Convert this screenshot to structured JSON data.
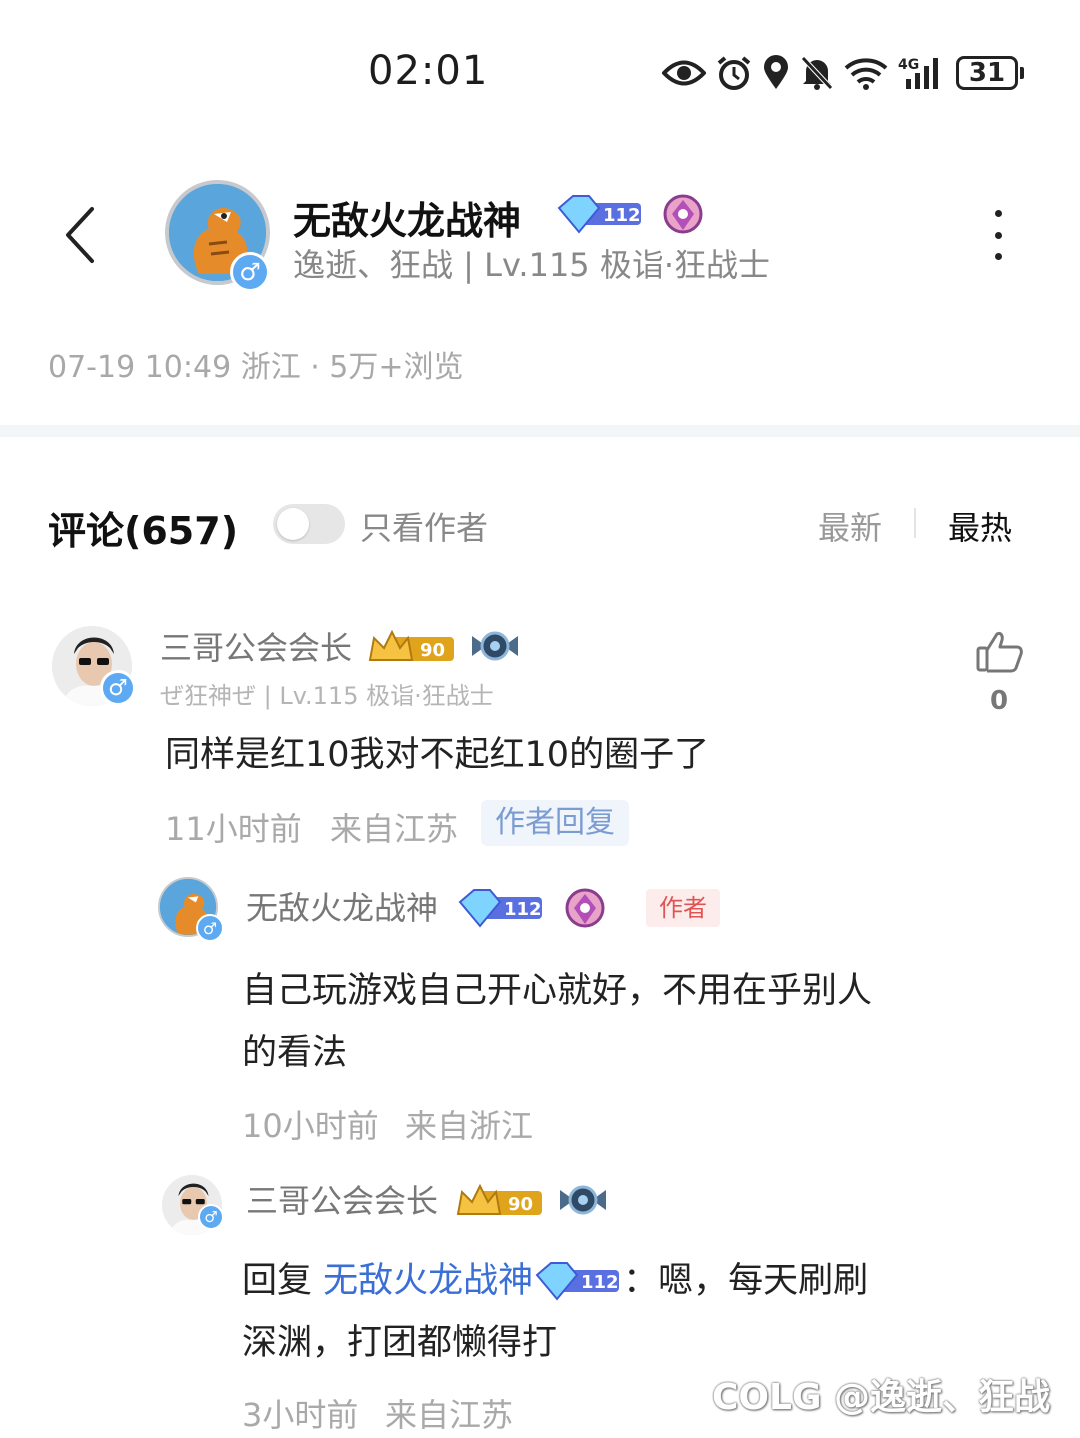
{
  "status_bar": {
    "time": "02:01",
    "network": "4G",
    "battery": "31"
  },
  "header": {
    "name": "无敌火龙战神",
    "level_badge": "112",
    "subtitle": "逸逝、狂战 | Lv.115 极诣·狂战士",
    "gender": "♂"
  },
  "post_meta": "07-19 10:49 浙江 · 5万+浏览",
  "comments_header": {
    "title": "评论(657)",
    "author_only": "只看作者",
    "sort_new": "最新",
    "sort_hot": "最热"
  },
  "comments": [
    {
      "name": "三哥公会会长",
      "level_badge": "90",
      "subtitle": "ぜ狂神ぜ | Lv.115 极诣·狂战士",
      "gender": "♂",
      "text": "同样是红10我对不起红10的圈子了",
      "time": "11小时前",
      "location": "来自江苏",
      "tag": "作者回复",
      "likes": "0"
    }
  ],
  "replies": [
    {
      "name": "无敌火龙战神",
      "level_badge": "112",
      "tag": "作者",
      "gender": "♂",
      "text_line1": "自己玩游戏自己开心就好，不用在乎别人",
      "text_line2": "的看法",
      "time": "10小时前",
      "location": "来自浙江"
    },
    {
      "name": "三哥公会会长",
      "level_badge": "90",
      "gender": "♂",
      "reply_prefix": "回复 ",
      "reply_to": "无敌火龙战神",
      "reply_to_badge": "112",
      "text_line1": "：嗯，每天刷刷",
      "text_line2": "深渊，打团都懒得打",
      "time": "3小时前",
      "location": "来自江苏"
    }
  ],
  "watermark": "COLG @逸逝、狂战",
  "colors": {
    "accent_blue": "#3b6fd6",
    "gender_blue": "#5da9f2",
    "author_red": "#e05454",
    "gold": "#e0a41c"
  }
}
